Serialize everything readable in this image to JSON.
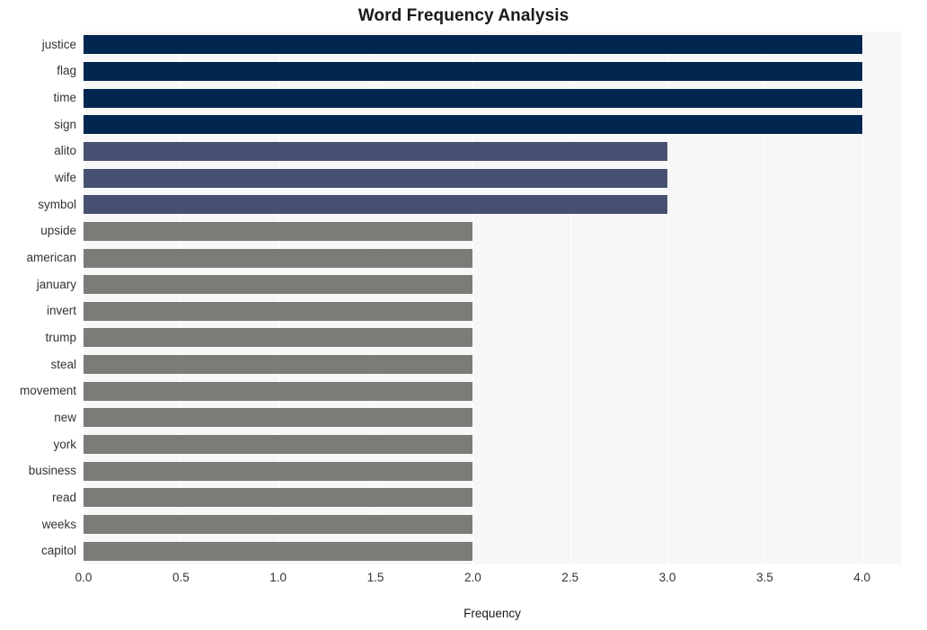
{
  "chart_data": {
    "type": "bar",
    "orientation": "horizontal",
    "title": "Word Frequency Analysis",
    "xlabel": "Frequency",
    "ylabel": "",
    "xlim": [
      0.0,
      4.2
    ],
    "xticks": [
      "0.0",
      "0.5",
      "1.0",
      "1.5",
      "2.0",
      "2.5",
      "3.0",
      "3.5",
      "4.0"
    ],
    "xtick_values": [
      0.0,
      0.5,
      1.0,
      1.5,
      2.0,
      2.5,
      3.0,
      3.5,
      4.0
    ],
    "grid": true,
    "grid_axis": "x",
    "legend": "none",
    "categories": [
      "justice",
      "flag",
      "time",
      "sign",
      "alito",
      "wife",
      "symbol",
      "upside",
      "american",
      "january",
      "invert",
      "trump",
      "steal",
      "movement",
      "new",
      "york",
      "business",
      "read",
      "weeks",
      "capitol"
    ],
    "values": [
      4,
      4,
      4,
      4,
      3,
      3,
      3,
      2,
      2,
      2,
      2,
      2,
      2,
      2,
      2,
      2,
      2,
      2,
      2,
      2
    ],
    "bar_colors": [
      "#02264f",
      "#02264f",
      "#02264f",
      "#02264f",
      "#465070",
      "#465070",
      "#465070",
      "#7b7b78",
      "#7b7b78",
      "#7b7b78",
      "#7b7b78",
      "#7b7b78",
      "#7b7b78",
      "#7b7b78",
      "#7b7b78",
      "#7b7b78",
      "#7b7b78",
      "#7b7b78",
      "#7b7b78",
      "#7b7b78"
    ],
    "color_scale": {
      "high": "#02264f",
      "mid": "#465070",
      "low": "#7b7b78"
    },
    "plot_background": "#f7f7f7",
    "grid_color": "#ffffff",
    "figure_background": "#ffffff"
  }
}
